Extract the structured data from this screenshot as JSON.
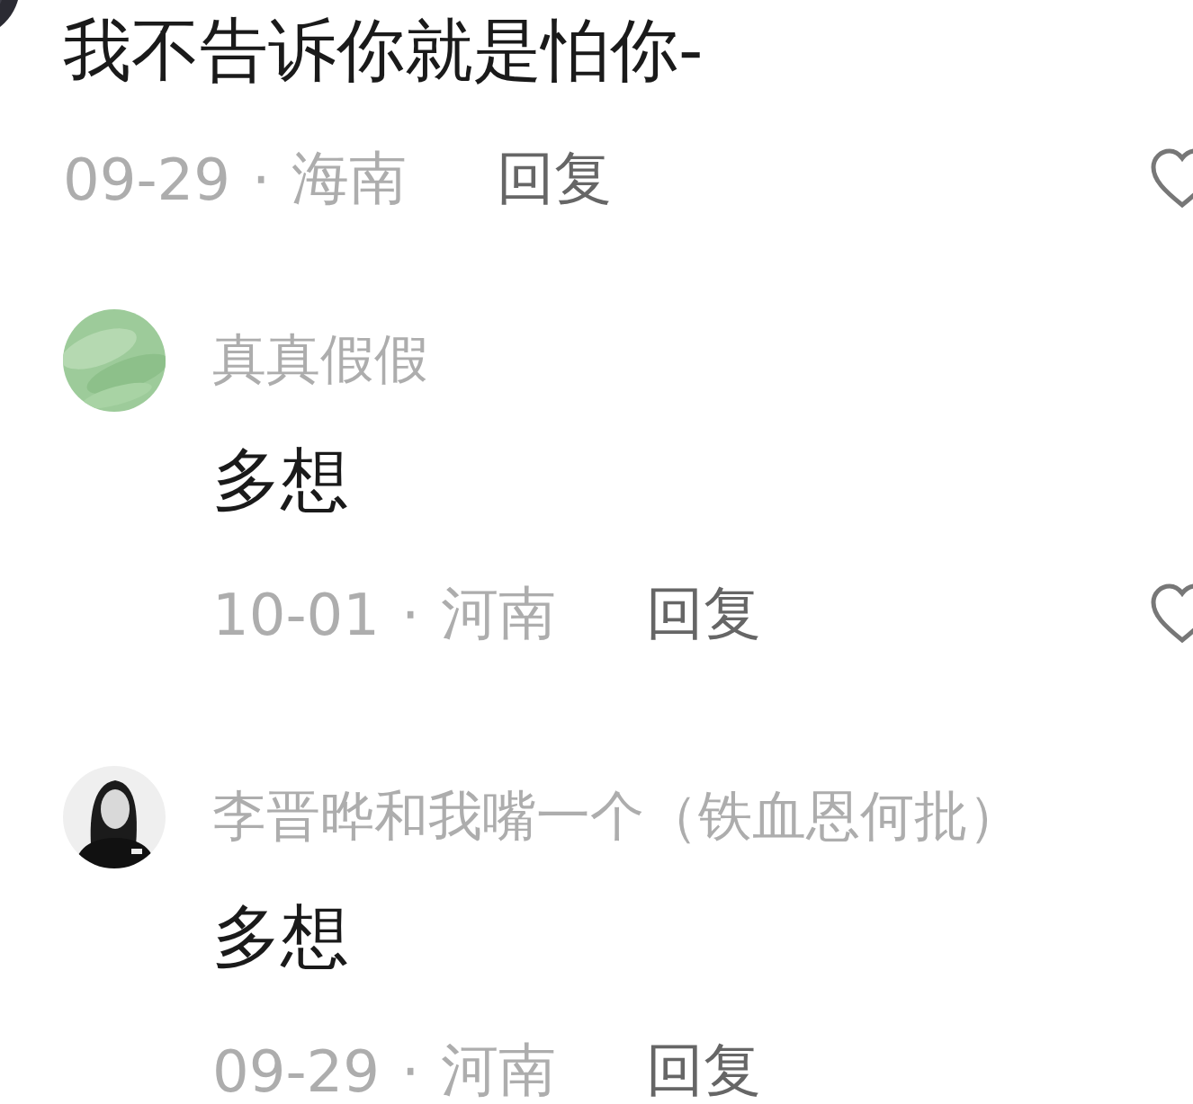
{
  "comment": {
    "text": "我不告诉你就是怕你-",
    "date": "09-29",
    "separator": "·",
    "region": "海南",
    "reply_label": "回复",
    "like_icon": true
  },
  "replies": [
    {
      "name": "真真假假",
      "text": "多想",
      "date": "10-01",
      "separator": "·",
      "region": "河南",
      "reply_label": "回复",
      "like_icon": true
    },
    {
      "name": "李晋晔和我嘴一个（铁血恩何批）",
      "text": "多想",
      "date": "09-29",
      "separator": "·",
      "region": "河南",
      "reply_label": "回复",
      "like_icon": false
    }
  ]
}
